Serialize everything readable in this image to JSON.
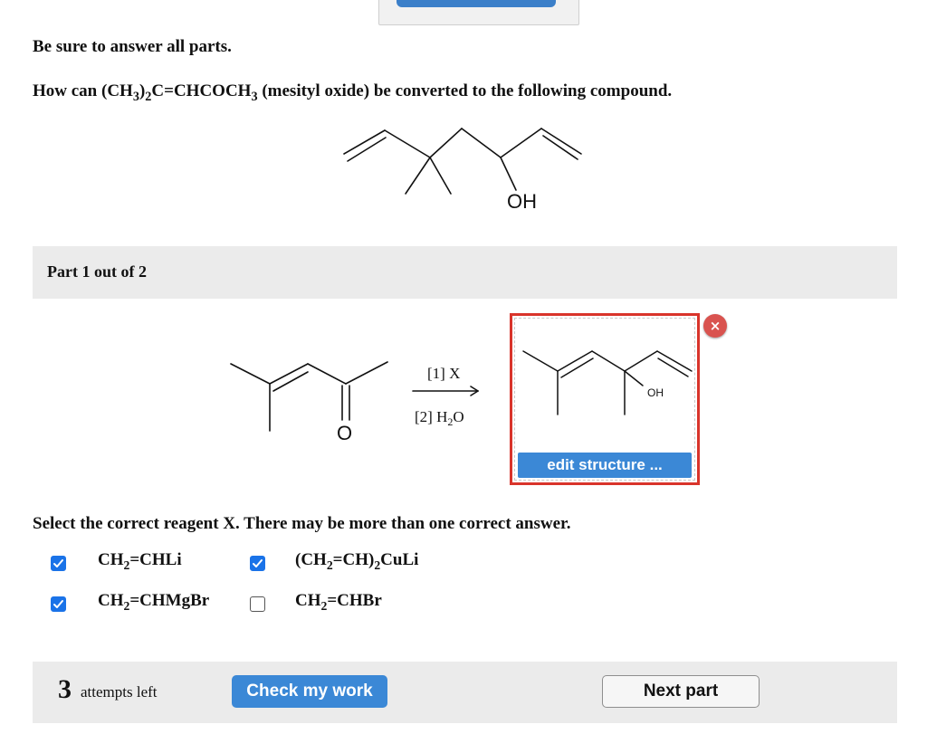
{
  "header": {
    "instruction": "Be sure to answer all parts.",
    "question": {
      "prefix": "How can (CH",
      "s1": "3",
      "m1": ")",
      "s2": "2",
      "m2": "C=CHCOCH",
      "s3": "3",
      "suffix": " (mesityl oxide) be converted to the following compound."
    },
    "target_label": "OH"
  },
  "part": {
    "label": "Part 1 out of 2"
  },
  "reaction": {
    "reactant_label": "O",
    "step1": "[1] X",
    "step2_prefix": "[2] H",
    "step2_sub": "2",
    "step2_suffix": "O",
    "product_label": "OH",
    "edit_label": "edit structure ...",
    "close_label": "×"
  },
  "select": {
    "prompt": "Select the correct reagent X. There may be more than one correct answer.",
    "options": [
      {
        "checked": true,
        "a": "CH",
        "sub1": "2",
        "b": "=CHLi",
        "sub2": "",
        "c": ""
      },
      {
        "checked": true,
        "a": "(CH",
        "sub1": "2",
        "b": "=CH)",
        "sub2": "2",
        "c": "CuLi"
      },
      {
        "checked": true,
        "a": "CH",
        "sub1": "2",
        "b": "=CHMgBr",
        "sub2": "",
        "c": ""
      },
      {
        "checked": false,
        "a": "CH",
        "sub1": "2",
        "b": "=CHBr",
        "sub2": "",
        "c": ""
      }
    ]
  },
  "footer": {
    "attempts_num": "3",
    "attempts_text": "attempts left",
    "check_label": "Check my work",
    "next_label": "Next part"
  },
  "colors": {
    "accent": "#3b88d6",
    "error_border": "#d9342b",
    "panel_bg": "#ebebeb"
  }
}
